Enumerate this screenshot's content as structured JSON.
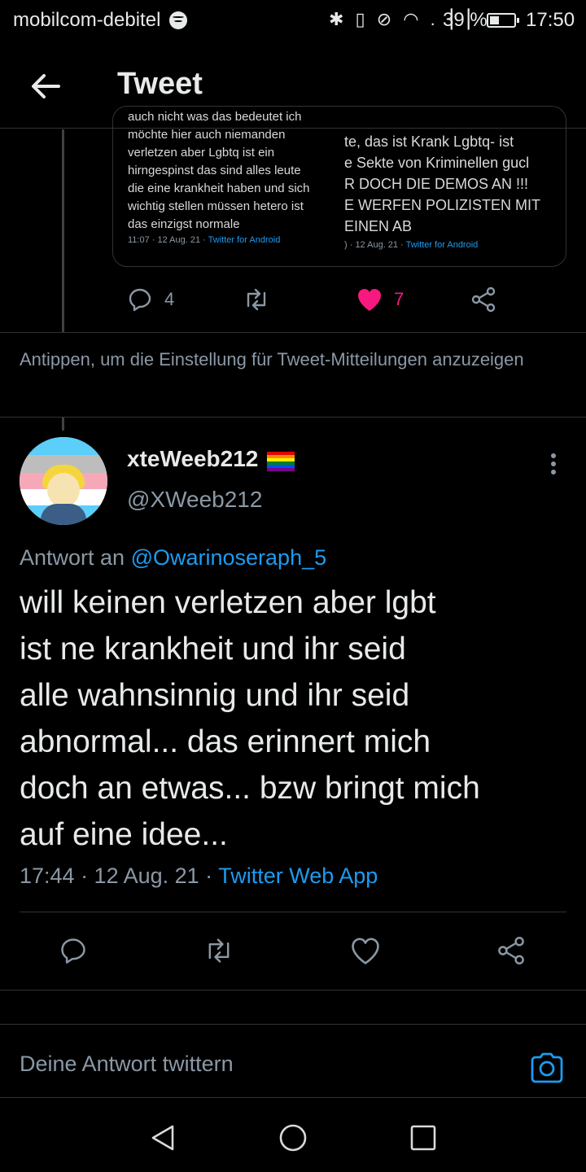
{
  "status_bar": {
    "carrier": "mobilcom-debitel",
    "icons_text": "✱ ▯ ⊘ ◠ .▕▕",
    "battery_percent_label": "39 %",
    "battery_level": 0.39,
    "time": "17:50"
  },
  "header": {
    "title": "Tweet"
  },
  "parent_tweet": {
    "quoted_screenshot_left": {
      "lines": [
        "auch nicht was das bedeutet ich",
        "möchte hier auch niemanden",
        "verletzen aber Lgbtq ist ein",
        "hirngespinst das sind alles leute",
        "die eine krankheit haben und sich",
        "wichtig stellen müssen hetero ist",
        "das einzigst normale"
      ],
      "meta": "11:07 · 12 Aug. 21 ·",
      "source": "Twitter for Android"
    },
    "quoted_screenshot_right": {
      "lines": [
        "te, das ist Krank Lgbtq- ist",
        "e Sekte von Kriminellen gucl",
        "R DOCH DIE DEMOS AN !!!",
        "E WERFEN POLIZISTEN MIT",
        "EINEN AB"
      ],
      "meta": ") · 12 Aug. 21 ·",
      "source": "Twitter for Android"
    },
    "reply_count": "4",
    "like_count": "7"
  },
  "notification_setting_hint": "Antippen, um die Einstellung für Tweet-Mitteilungen anzuzeigen",
  "tweet": {
    "display_name": "xteWeeb212",
    "handle": "@XWeeb212",
    "reply_prefix": "Antwort an ",
    "reply_mention": "@Owarinoseraph_5",
    "text_lines": [
      "will keinen verletzen aber lgbt",
      "ist ne krankheit und ihr seid",
      "alle wahnsinnig und ihr seid",
      "abnormal... das erinnert mich",
      "doch an etwas... bzw bringt mich",
      "auf eine idee..."
    ],
    "timestamp": "17:44 · 12 Aug. 21 · ",
    "source": "Twitter Web App"
  },
  "composer": {
    "placeholder": "Deine Antwort twittern"
  },
  "colors": {
    "background": "#000000",
    "accent": "#1d9bf0",
    "like": "#f91880",
    "muted": "#8b98a5",
    "divider": "#2f3336"
  }
}
